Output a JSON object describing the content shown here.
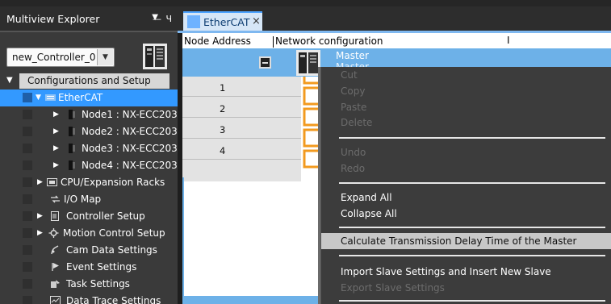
{
  "explorer": {
    "title": "Multiview Explorer",
    "pin_glyph": "— Ч",
    "controller": {
      "value": "new_Controller_0"
    },
    "root_label": "Configurations and Setup",
    "items": [
      {
        "label": "EtherCAT",
        "icon": "ethercat-icon"
      },
      {
        "label": "Node1 : NX-ECC203",
        "icon": "node-icon"
      },
      {
        "label": "Node2 : NX-ECC203",
        "icon": "node-icon"
      },
      {
        "label": "Node3 : NX-ECC203",
        "icon": "node-icon"
      },
      {
        "label": "Node4 : NX-ECC203",
        "icon": "node-icon"
      },
      {
        "label": "CPU/Expansion Racks",
        "icon": "rack-icon"
      },
      {
        "label": "I/O Map",
        "icon": "io-map-icon"
      },
      {
        "label": "Controller Setup",
        "icon": "controller-setup-icon"
      },
      {
        "label": "Motion Control Setup",
        "icon": "gear-icon"
      },
      {
        "label": "Cam Data Settings",
        "icon": "cam-icon"
      },
      {
        "label": "Event Settings",
        "icon": "flag-icon"
      },
      {
        "label": "Task Settings",
        "icon": "task-icon"
      },
      {
        "label": "Data Trace Settings",
        "icon": "trace-icon"
      }
    ]
  },
  "editor": {
    "tab_label": "EtherCAT",
    "tab_close": "×",
    "col_node_address": "Node Address",
    "col_network": "Network configuration",
    "col_marker": "I",
    "master_label": "Master",
    "master_sublabel": "Master",
    "nodes": [
      "1",
      "2",
      "3",
      "4"
    ]
  },
  "context_menu": {
    "items": [
      {
        "label": "Cut",
        "enabled": false
      },
      {
        "label": "Copy",
        "enabled": false
      },
      {
        "label": "Paste",
        "enabled": false
      },
      {
        "label": "Delete",
        "enabled": false
      },
      {
        "label": "Undo",
        "enabled": false
      },
      {
        "label": "Redo",
        "enabled": false
      },
      {
        "label": "Expand All",
        "enabled": true
      },
      {
        "label": "Collapse All",
        "enabled": true
      },
      {
        "label": "Calculate Transmission Delay Time of the Master",
        "enabled": true,
        "highlighted": true
      },
      {
        "label": "Import Slave Settings and Insert New Slave",
        "enabled": true
      },
      {
        "label": "Export Slave Settings",
        "enabled": false
      }
    ]
  },
  "colors": {
    "selection": "#3399ff",
    "master_row": "#6db1e8",
    "chain": "#f29a1f",
    "menu_bg": "#3c3c3c"
  }
}
